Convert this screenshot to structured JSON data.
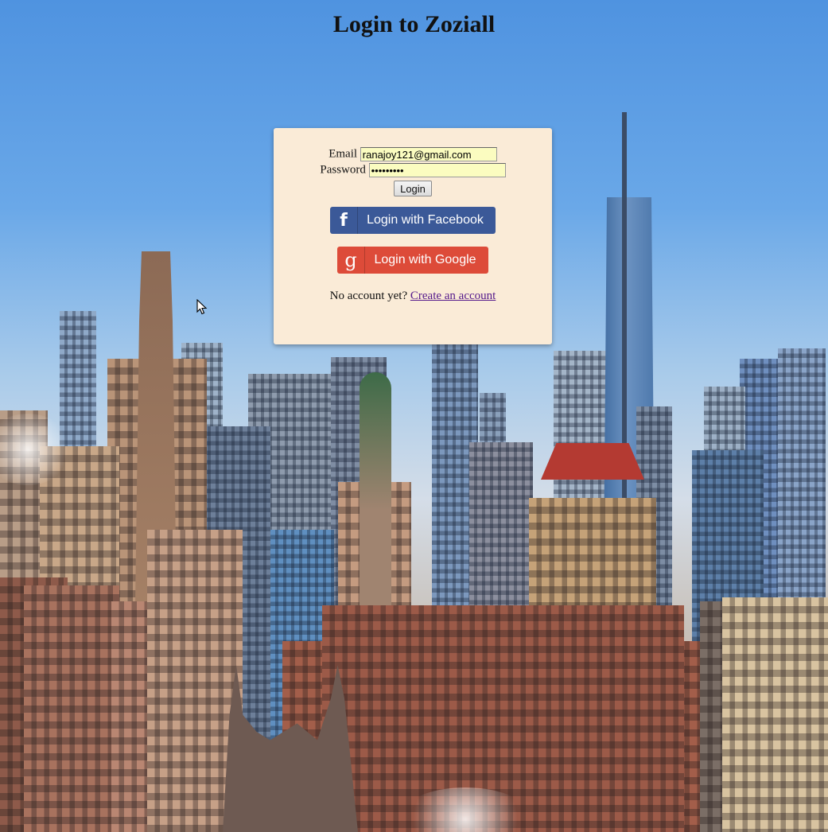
{
  "page": {
    "title": "Login to Zoziall"
  },
  "login_form": {
    "email_label": "Email",
    "email_value": "ranajoy121@gmail.com",
    "password_label": "Password",
    "password_value": "•••••••••",
    "login_button": "Login"
  },
  "social": {
    "facebook_icon": "f",
    "facebook_label": "Login with Facebook",
    "facebook_color": "#3b5998",
    "google_icon": "g",
    "google_label": "Login with Google",
    "google_color": "#dd4b39"
  },
  "signup": {
    "prompt": "No account yet?",
    "link_text": "Create an account"
  },
  "colors": {
    "panel_background": "#faebd7",
    "input_autofill": "#fbfcc0",
    "link_visited": "#551a8b"
  }
}
